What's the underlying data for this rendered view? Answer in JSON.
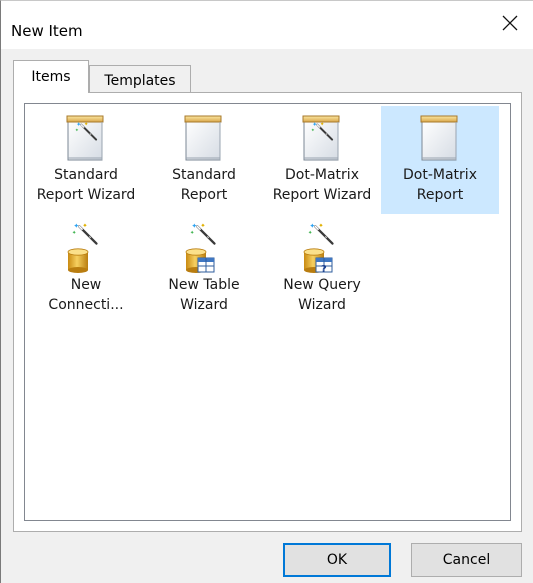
{
  "window": {
    "title": "New Item",
    "close_glyph": "✕"
  },
  "tabs": [
    {
      "label": "Items",
      "active": true
    },
    {
      "label": "Templates",
      "active": false
    }
  ],
  "items": [
    {
      "label": "Standard\nReport Wizard",
      "icon": "report-wizard-icon",
      "selected": false
    },
    {
      "label": "Standard\nReport",
      "icon": "report-icon",
      "selected": false
    },
    {
      "label": "Dot-Matrix\nReport Wizard",
      "icon": "report-wizard-icon",
      "selected": false
    },
    {
      "label": "Dot-Matrix\nReport",
      "icon": "report-icon",
      "selected": true
    },
    {
      "label": "New\nConnecti...",
      "icon": "connection-wizard-icon",
      "selected": false
    },
    {
      "label": "New Table\nWizard",
      "icon": "table-wizard-icon",
      "selected": false
    },
    {
      "label": "New Query\nWizard",
      "icon": "query-wizard-icon",
      "selected": false
    }
  ],
  "buttons": {
    "ok_label": "OK",
    "cancel_label": "Cancel"
  },
  "colors": {
    "selection": "#cce8ff",
    "default_button_border": "#0078d7"
  }
}
